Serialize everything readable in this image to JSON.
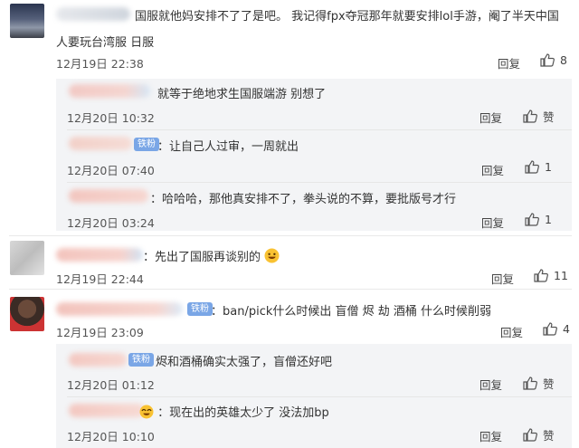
{
  "comments": [
    {
      "text1": "国服就他妈安排不了了是吧。  我记得fpx夺冠那年就要安排lol手游，阉了半天中国",
      "text2": "人要玩台湾服 日服",
      "date": "12月19日 22:38",
      "reply_label": "回复",
      "like_count": "8",
      "replies": [
        {
          "text": "就等于绝地求生国服端游 别想了",
          "date": "12月20日 10:32",
          "reply_label": "回复",
          "like_label": "赞"
        },
        {
          "badge": "铁粉",
          "text": "：让自己人过审，一周就出",
          "date": "12月20日 07:40",
          "reply_label": "回复",
          "like_count": "1"
        },
        {
          "text": "：哈哈哈，那他真安排不了，拳头说的不算，要批版号才行",
          "date": "12月20日 03:24",
          "reply_label": "回复",
          "like_count": "1"
        }
      ]
    },
    {
      "text": "：先出了国服再谈别的",
      "date": "12月19日 22:44",
      "reply_label": "回复",
      "like_count": "11"
    },
    {
      "badge": "铁粉",
      "text": "：ban/pick什么时候出 盲僧 烬 劫 酒桶 什么时候削弱",
      "date": "12月19日 23:09",
      "reply_label": "回复",
      "like_count": "4",
      "replies": [
        {
          "badge": "铁粉",
          "text": "烬和酒桶确实太强了，盲僧还好吧",
          "date": "12月20日 01:12",
          "reply_label": "回复",
          "like_label": "赞"
        },
        {
          "text": "：现在出的英雄太少了 没法加bp",
          "date": "12月20日 10:10",
          "reply_label": "回复",
          "like_label": "赞"
        }
      ]
    }
  ],
  "colors": {
    "badge": "#7aa6e6",
    "reply_bg": "#f3f4f6",
    "text": "#333333",
    "meta": "#555555"
  }
}
